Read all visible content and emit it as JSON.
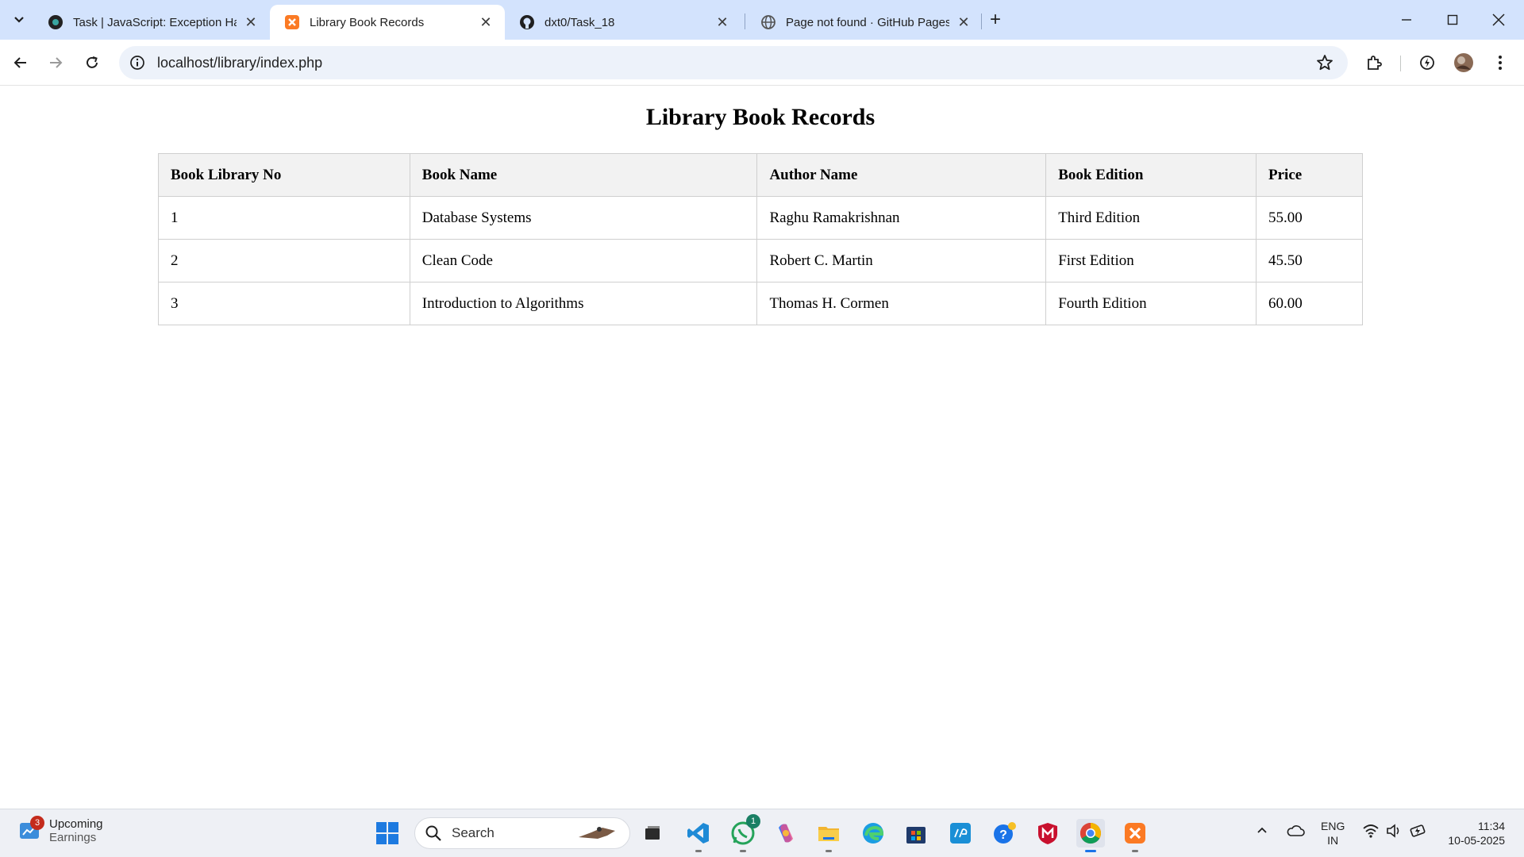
{
  "tabs": [
    {
      "title": "Task | JavaScript: Exception Han",
      "close": "✕",
      "favicon": "dark-circle-icon"
    },
    {
      "title": "Library Book Records",
      "close": "✕",
      "favicon": "xampp-icon",
      "active": true
    },
    {
      "title": "dxt0/Task_18",
      "close": "✕",
      "favicon": "github-icon"
    },
    {
      "title": "Page not found · GitHub Pages",
      "close": "✕",
      "favicon": "globe-icon"
    }
  ],
  "new_tab": "+",
  "address_bar": {
    "url": "localhost/library/index.php"
  },
  "page": {
    "heading": "Library Book Records",
    "table": {
      "headers": [
        "Book Library No",
        "Book Name",
        "Author Name",
        "Book Edition",
        "Price"
      ],
      "rows": [
        [
          "1",
          "Database Systems",
          "Raghu Ramakrishnan",
          "Third Edition",
          "55.00"
        ],
        [
          "2",
          "Clean Code",
          "Robert C. Martin",
          "First Edition",
          "45.50"
        ],
        [
          "3",
          "Introduction to Algorithms",
          "Thomas H. Cormen",
          "Fourth Edition",
          "60.00"
        ]
      ]
    }
  },
  "taskbar": {
    "widget": {
      "badge": "3",
      "line1": "Upcoming",
      "line2": "Earnings"
    },
    "search_label": "Search",
    "whatsapp_badge": "1",
    "lang_line1": "ENG",
    "lang_line2": "IN",
    "time": "11:34",
    "date": "10-05-2025"
  },
  "colors": {
    "tabstrip": "#d3e3fd",
    "omnibox": "#edf2fa",
    "table_header_bg": "#f2f2f2",
    "taskbar": "#eef0f5"
  }
}
